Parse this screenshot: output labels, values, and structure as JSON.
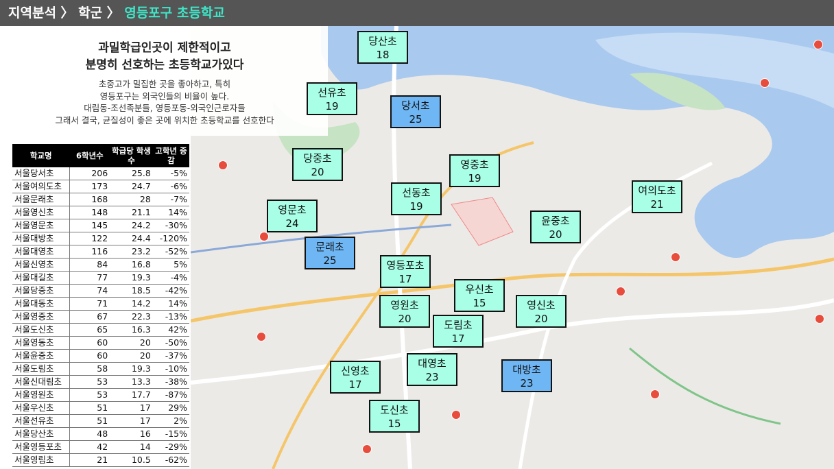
{
  "header": {
    "breadcrumb_main": "지역분석 〉 학군 〉 ",
    "breadcrumb_accent": "영등포구 초등학교"
  },
  "intro": {
    "headline": [
      "과밀학급인곳이 제한적이고",
      "분명히 선호하는 초등학교가있다"
    ],
    "body": [
      "초중고가 밀집한 곳을 좋아하고, 특히",
      "영등포구는 외국인들의 비율이 높다.",
      "대림동-조선족분들, 영등포동-외국인근로자들",
      "그래서 결국, 균질성이 좋은 곳에 위치한 초등학교를 선호한다"
    ]
  },
  "table": {
    "headers": [
      "학교명",
      "6학년수",
      "학급당 학생수",
      "고학년 증감"
    ],
    "rows": [
      [
        "서울당서초",
        "206",
        "25.8",
        "-5%"
      ],
      [
        "서울여의도초",
        "173",
        "24.7",
        "-6%"
      ],
      [
        "서울문래초",
        "168",
        "28",
        "-7%"
      ],
      [
        "서울영신초",
        "148",
        "21.1",
        "14%"
      ],
      [
        "서울영문초",
        "145",
        "24.2",
        "-30%"
      ],
      [
        "서울대방초",
        "122",
        "24.4",
        "-120%"
      ],
      [
        "서울대영초",
        "116",
        "23.2",
        "-52%"
      ],
      [
        "서울신영초",
        "84",
        "16.8",
        "5%"
      ],
      [
        "서울대길초",
        "77",
        "19.3",
        "-4%"
      ],
      [
        "서울당중초",
        "74",
        "18.5",
        "-42%"
      ],
      [
        "서울대동초",
        "71",
        "14.2",
        "14%"
      ],
      [
        "서울영중초",
        "67",
        "22.3",
        "-13%"
      ],
      [
        "서울도신초",
        "65",
        "16.3",
        "42%"
      ],
      [
        "서울영동초",
        "60",
        "20",
        "-50%"
      ],
      [
        "서울윤중초",
        "60",
        "20",
        "-37%"
      ],
      [
        "서울도림초",
        "58",
        "19.3",
        "-10%"
      ],
      [
        "서울신대림초",
        "53",
        "13.3",
        "-38%"
      ],
      [
        "서울영원초",
        "53",
        "17.7",
        "-87%"
      ],
      [
        "서울우신초",
        "51",
        "17",
        "29%"
      ],
      [
        "서울선유초",
        "51",
        "17",
        "2%"
      ],
      [
        "서울당산초",
        "48",
        "16",
        "-15%"
      ],
      [
        "서울영등포초",
        "42",
        "14",
        "-29%"
      ],
      [
        "서울영림초",
        "21",
        "10.5",
        "-62%"
      ]
    ]
  },
  "map": {
    "labels": [
      {
        "name": "당산초",
        "value": "18",
        "color": "mint"
      },
      {
        "name": "선유초",
        "value": "19",
        "color": "mint"
      },
      {
        "name": "당서초",
        "value": "25",
        "color": "blue"
      },
      {
        "name": "당중초",
        "value": "20",
        "color": "mint"
      },
      {
        "name": "영중초",
        "value": "19",
        "color": "mint"
      },
      {
        "name": "선동초",
        "value": "19",
        "color": "mint"
      },
      {
        "name": "여의도초",
        "value": "21",
        "color": "mint"
      },
      {
        "name": "영문초",
        "value": "24",
        "color": "mint"
      },
      {
        "name": "윤중초",
        "value": "20",
        "color": "mint"
      },
      {
        "name": "문래초",
        "value": "25",
        "color": "blue"
      },
      {
        "name": "영등포초",
        "value": "17",
        "color": "mint"
      },
      {
        "name": "우신초",
        "value": "15",
        "color": "mint"
      },
      {
        "name": "영원초",
        "value": "20",
        "color": "mint"
      },
      {
        "name": "영신초",
        "value": "20",
        "color": "mint"
      },
      {
        "name": "도림초",
        "value": "17",
        "color": "mint"
      },
      {
        "name": "대영초",
        "value": "23",
        "color": "mint"
      },
      {
        "name": "신영초",
        "value": "17",
        "color": "mint"
      },
      {
        "name": "대방초",
        "value": "23",
        "color": "blue"
      },
      {
        "name": "도신초",
        "value": "15",
        "color": "mint"
      }
    ]
  }
}
